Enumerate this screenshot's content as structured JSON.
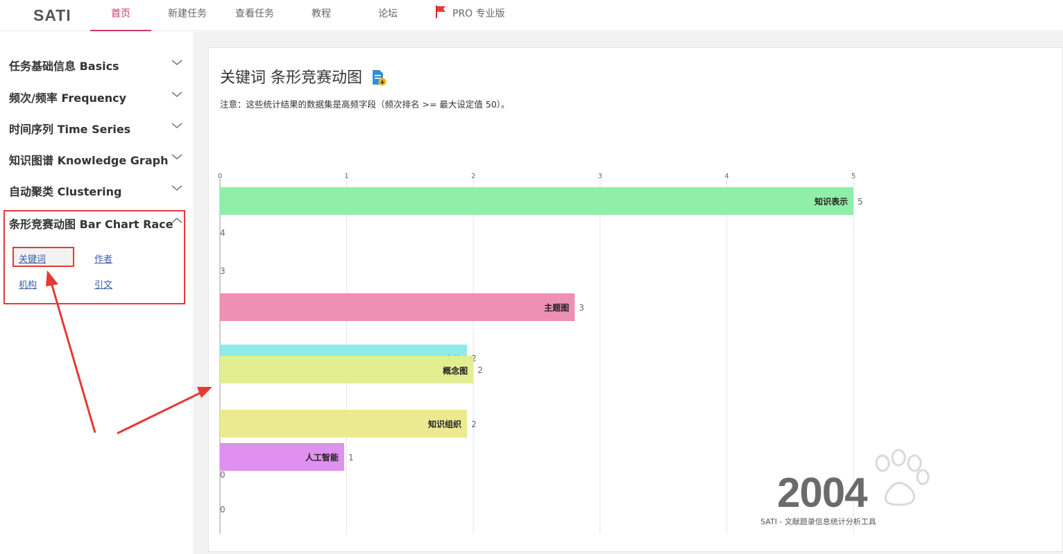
{
  "app": {
    "logo": "SATI"
  },
  "nav": {
    "items": [
      {
        "label": "首页",
        "active": true
      },
      {
        "label": "新建任务"
      },
      {
        "label": "查看任务"
      },
      {
        "label": "教程"
      },
      {
        "label": "论坛"
      },
      {
        "label": "PRO 专业版",
        "icon": "flag-icon"
      }
    ]
  },
  "sidebar": {
    "items": [
      {
        "label": "任务基础信息 Basics",
        "expanded": false
      },
      {
        "label": "频次/频率 Frequency",
        "expanded": false
      },
      {
        "label": "时间序列 Time Series",
        "expanded": false
      },
      {
        "label": "知识图谱 Knowledge Graph",
        "expanded": false
      },
      {
        "label": "自动聚类 Clustering",
        "expanded": false
      },
      {
        "label": "条形竞赛动图 Bar Chart Race",
        "expanded": true
      }
    ],
    "sublinks": [
      "关键词",
      "作者",
      "机构",
      "引文"
    ]
  },
  "main": {
    "title": "关键词 条形竞赛动图",
    "note": "注意：这些统计结果的数据集是高频字段（频次排名 >= 最大设定值 50）。",
    "year": "2004",
    "caption": "SATI - 文献题录信息统计分析工具"
  },
  "chart_data": {
    "type": "bar",
    "orientation": "horizontal",
    "xlim": [
      0,
      5
    ],
    "xticks": [
      "0",
      "1",
      "2",
      "3",
      "4",
      "5"
    ],
    "bars": [
      {
        "label": "知识表示",
        "value": 5,
        "value_text": "5",
        "color": "#90eea8"
      },
      {
        "label": "",
        "value": 0,
        "value_text": "4",
        "color": ""
      },
      {
        "label": "",
        "value": 0,
        "value_text": "3",
        "color": ""
      },
      {
        "label": "主题图",
        "value": 2.8,
        "value_text": "3",
        "color": "#ee90b4"
      },
      {
        "label": "本体",
        "value": 1.95,
        "value_text": "2",
        "color": "#90eaea"
      },
      {
        "label": "概念图",
        "value": 2,
        "value_text": "2",
        "color": "#e2ee90"
      },
      {
        "label": "知识组织",
        "value": 1.95,
        "value_text": "2",
        "color": "#ecea90"
      },
      {
        "label": "人工智能",
        "value": 0.98,
        "value_text": "1",
        "color": "#e090ee"
      },
      {
        "label": "",
        "value": 0,
        "value_text": "0",
        "color": ""
      },
      {
        "label": "",
        "value": 0,
        "value_text": "0",
        "color": ""
      }
    ]
  },
  "colors": {
    "accent": "#d6336c",
    "highlight": "#e53935",
    "link": "#3a5fa8"
  }
}
